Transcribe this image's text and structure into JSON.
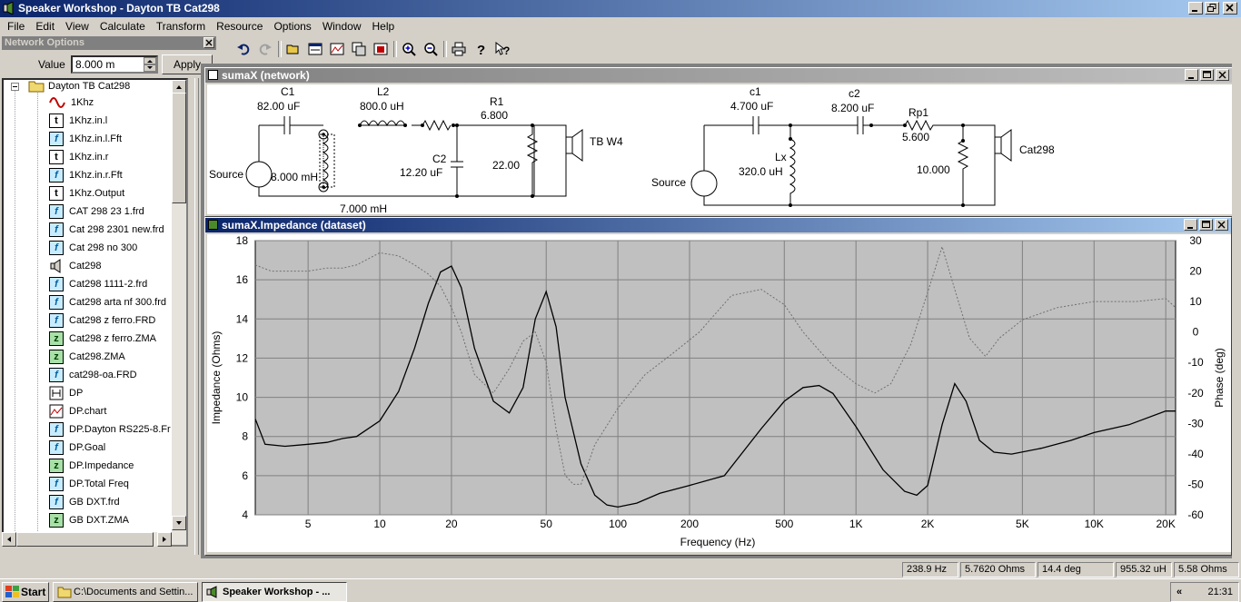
{
  "app": {
    "title": "Speaker Workshop - Dayton TB Cat298"
  },
  "menu": [
    "File",
    "Edit",
    "View",
    "Calculate",
    "Transform",
    "Resource",
    "Options",
    "Window",
    "Help"
  ],
  "network_options": {
    "title": "Network Options",
    "value_label": "Value",
    "value": "8.000 m",
    "apply_label": "Apply"
  },
  "tree": {
    "root": "Dayton TB Cat298",
    "items": [
      {
        "icon": "sine",
        "label": "1Khz"
      },
      {
        "icon": "t",
        "label": "1Khz.in.l"
      },
      {
        "icon": "f",
        "label": "1Khz.in.l.Fft"
      },
      {
        "icon": "t",
        "label": "1Khz.in.r"
      },
      {
        "icon": "f",
        "label": "1Khz.in.r.Fft"
      },
      {
        "icon": "t",
        "label": "1Khz.Output"
      },
      {
        "icon": "f",
        "label": "CAT 298 23 1.frd"
      },
      {
        "icon": "f",
        "label": "Cat 298 2301 new.frd"
      },
      {
        "icon": "f",
        "label": "Cat 298 no 300"
      },
      {
        "icon": "speaker",
        "label": "Cat298"
      },
      {
        "icon": "f",
        "label": "Cat298 1111-2.frd"
      },
      {
        "icon": "f",
        "label": "Cat298 arta nf 300.frd"
      },
      {
        "icon": "f",
        "label": "Cat298 z ferro.FRD"
      },
      {
        "icon": "z",
        "label": "Cat298 z ferro.ZMA"
      },
      {
        "icon": "z",
        "label": "Cat298.ZMA"
      },
      {
        "icon": "f",
        "label": "cat298-oa.FRD"
      },
      {
        "icon": "net",
        "label": "DP"
      },
      {
        "icon": "chart",
        "label": "DP.chart"
      },
      {
        "icon": "f",
        "label": "DP.Dayton RS225-8.Fr"
      },
      {
        "icon": "f",
        "label": "DP.Goal"
      },
      {
        "icon": "z",
        "label": "DP.Impedance"
      },
      {
        "icon": "f",
        "label": "DP.Total Freq"
      },
      {
        "icon": "f",
        "label": "GB DXT.frd"
      },
      {
        "icon": "z",
        "label": "GB DXT.ZMA"
      }
    ]
  },
  "network_window": {
    "title": "sumaX (network)",
    "left": {
      "c1_name": "C1",
      "c1_value": "82.00 uF",
      "l2_name": "L2",
      "l2_value": "800.0 uH",
      "r1_name": "R1",
      "r1_value": "6.800",
      "c2_name": "C2",
      "c2_value": "12.20 uF",
      "r_shunt_value": "22.00",
      "source_label": "Source",
      "l_shunt_value": "8.000 mH",
      "l_shunt_value2": "7.000 mH",
      "driver": "TB W4"
    },
    "right": {
      "c1_name": "c1",
      "c1_value": "4.700 uF",
      "c2_name": "c2",
      "c2_value": "8.200 uF",
      "rp1_name": "Rp1",
      "rp1_value": "5.600",
      "lx_name": "Lx",
      "lx_value": "320.0 uH",
      "r_shunt_value": "10.000",
      "source_label": "Source",
      "driver": "Cat298"
    }
  },
  "chart_window": {
    "title": "sumaX.Impedance (dataset)"
  },
  "chart_data": {
    "type": "line",
    "xlabel": "Frequency (Hz)",
    "ylabel": "Impedance (Ohms)",
    "y2label": "Phase (deg)",
    "xscale": "log",
    "xlim": [
      3,
      22000
    ],
    "ylim": [
      4,
      18
    ],
    "y2lim": [
      -60,
      30
    ],
    "grid": true,
    "xticks": [
      5,
      10,
      20,
      50,
      100,
      200,
      500,
      1000,
      2000,
      5000,
      10000,
      20000
    ],
    "xticklabels": [
      "5",
      "10",
      "20",
      "50",
      "100",
      "200",
      "500",
      "1K",
      "2K",
      "5K",
      "10K",
      "20K"
    ],
    "yticks": [
      4,
      6,
      8,
      10,
      12,
      14,
      16,
      18
    ],
    "y2ticks": [
      30,
      20,
      10,
      0,
      -10,
      -20,
      -30,
      -40,
      -50,
      -60
    ],
    "series": [
      {
        "axis": "left",
        "style": "solid",
        "x": [
          3,
          3.3,
          4,
          5,
          6,
          7,
          8,
          10,
          12,
          14,
          16,
          18,
          20,
          22,
          25,
          30,
          35,
          40,
          45,
          50,
          55,
          60,
          70,
          80,
          90,
          100,
          120,
          150,
          200,
          280,
          400,
          500,
          600,
          700,
          800,
          1000,
          1300,
          1600,
          1800,
          2000,
          2300,
          2600,
          2900,
          3300,
          3800,
          4500,
          6000,
          8000,
          10000,
          14000,
          20000,
          22000
        ],
        "y": [
          8.9,
          7.6,
          7.5,
          7.6,
          7.7,
          7.9,
          8.0,
          8.8,
          10.3,
          12.5,
          14.8,
          16.4,
          16.7,
          15.6,
          12.5,
          9.8,
          9.2,
          10.5,
          14.0,
          15.4,
          13.6,
          10.0,
          6.6,
          5.0,
          4.5,
          4.4,
          4.6,
          5.1,
          5.5,
          6.0,
          8.4,
          9.8,
          10.5,
          10.6,
          10.2,
          8.5,
          6.3,
          5.2,
          5.0,
          5.5,
          8.6,
          10.7,
          9.8,
          7.8,
          7.2,
          7.1,
          7.4,
          7.8,
          8.2,
          8.6,
          9.3,
          9.3
        ]
      },
      {
        "axis": "right",
        "style": "dotted",
        "x": [
          3,
          3.5,
          4,
          5,
          6,
          7,
          8,
          10,
          12,
          14,
          16,
          18,
          20,
          22,
          25,
          30,
          35,
          40,
          45,
          50,
          55,
          60,
          65,
          70,
          80,
          100,
          130,
          170,
          220,
          300,
          400,
          500,
          600,
          700,
          800,
          1000,
          1200,
          1400,
          1700,
          2000,
          2300,
          2600,
          3000,
          3500,
          4000,
          5000,
          7000,
          10000,
          15000,
          20000,
          22000
        ],
        "y": [
          22,
          20,
          20,
          20,
          21,
          21,
          22,
          26,
          25,
          22,
          19,
          15,
          8,
          0,
          -14,
          -20,
          -12,
          -3,
          0,
          -10,
          -32,
          -47,
          -50,
          -50,
          -37,
          -25,
          -14,
          -7,
          0,
          12,
          14,
          9,
          0,
          -6,
          -11,
          -17,
          -20,
          -17,
          -4,
          13,
          28,
          14,
          -2,
          -8,
          -2,
          4,
          8,
          10,
          10,
          11,
          8
        ]
      }
    ]
  },
  "status": [
    "238.9 Hz",
    "5.7620 Ohms",
    "14.4 deg",
    "955.32 uH",
    "5.58 Ohms"
  ],
  "taskbar": {
    "start": "Start",
    "tasks": [
      "C:\\Documents and Settin...",
      "Speaker Workshop - ..."
    ],
    "clock": "21:31"
  }
}
